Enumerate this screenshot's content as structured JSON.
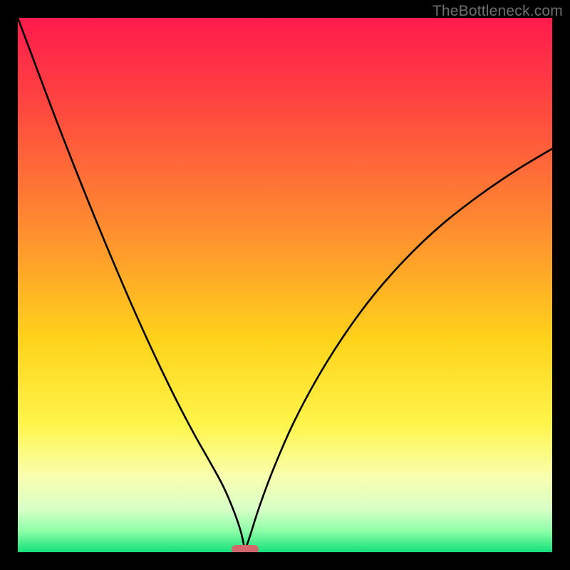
{
  "watermark": "TheBottleneck.com",
  "chart_data": {
    "type": "line",
    "title": "",
    "xlabel": "",
    "ylabel": "",
    "xlim": [
      0,
      100
    ],
    "ylim": [
      0,
      100
    ],
    "gradient_stops": [
      {
        "offset": 0,
        "color": "#ff1a4d"
      },
      {
        "offset": 0.18,
        "color": "#ff4b3f"
      },
      {
        "offset": 0.4,
        "color": "#ff8f2f"
      },
      {
        "offset": 0.6,
        "color": "#ffd21a"
      },
      {
        "offset": 0.76,
        "color": "#fff54a"
      },
      {
        "offset": 0.86,
        "color": "#f8ffb0"
      },
      {
        "offset": 0.92,
        "color": "#d8ffc8"
      },
      {
        "offset": 0.96,
        "color": "#8effa8"
      },
      {
        "offset": 1.0,
        "color": "#14e07a"
      }
    ],
    "series": [
      {
        "name": "left-curve",
        "x": [
          0.0,
          3.0,
          6.0,
          9.0,
          12.0,
          15.0,
          18.0,
          21.0,
          24.0,
          27.0,
          30.0,
          33.0,
          36.0,
          38.5,
          40.5,
          41.8,
          42.5
        ],
        "y": [
          100.0,
          92.0,
          84.0,
          76.2,
          68.6,
          61.2,
          54.0,
          47.0,
          40.3,
          33.9,
          27.8,
          22.1,
          16.8,
          12.2,
          7.5,
          3.6,
          0.2
        ]
      },
      {
        "name": "right-curve",
        "x": [
          42.5,
          43.5,
          45.2,
          47.8,
          51.5,
          56.0,
          61.0,
          66.5,
          72.5,
          79.0,
          86.0,
          93.0,
          100.0
        ],
        "y": [
          0.2,
          3.2,
          8.5,
          15.5,
          24.0,
          32.5,
          40.5,
          48.0,
          54.8,
          61.0,
          66.5,
          71.3,
          75.5
        ]
      }
    ],
    "marker": {
      "x": 42.5,
      "y": 0.6,
      "color": "#d4676d"
    }
  }
}
